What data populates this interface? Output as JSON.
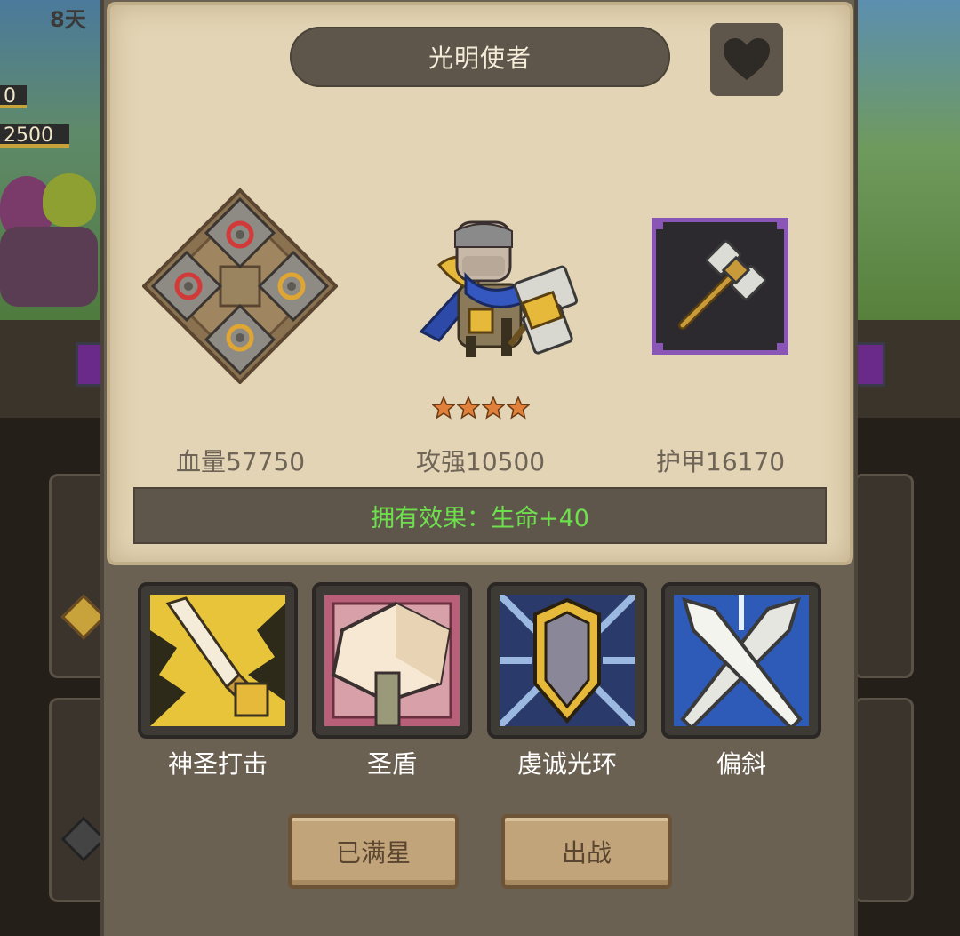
{
  "background": {
    "day_label": "8天",
    "hp_bars": [
      "0",
      "2500"
    ]
  },
  "panel": {
    "title": "光明使者",
    "favorite_icon": "heart-icon",
    "rune_icon": "rune-board-icon",
    "hero_icon": "paladin-hero-portrait",
    "weapon_icon": "war-hammer-icon",
    "star_count": 4,
    "stats": {
      "hp": "血量57750",
      "attack": "攻强10500",
      "armor": "护甲16170"
    },
    "effect": "拥有效果：生命+40",
    "colors": {
      "effect_text": "#6ee04e",
      "weapon_border": "#8a56b6",
      "star": "#e0803a"
    }
  },
  "skills": [
    {
      "name": "神圣打击",
      "icon": "holy-strike-icon"
    },
    {
      "name": "圣盾",
      "icon": "holy-shield-icon"
    },
    {
      "name": "虔诚光环",
      "icon": "devotion-aura-icon"
    },
    {
      "name": "偏斜",
      "icon": "deflect-icon"
    }
  ],
  "buttons": {
    "max_star": "已满星",
    "deploy": "出战"
  }
}
